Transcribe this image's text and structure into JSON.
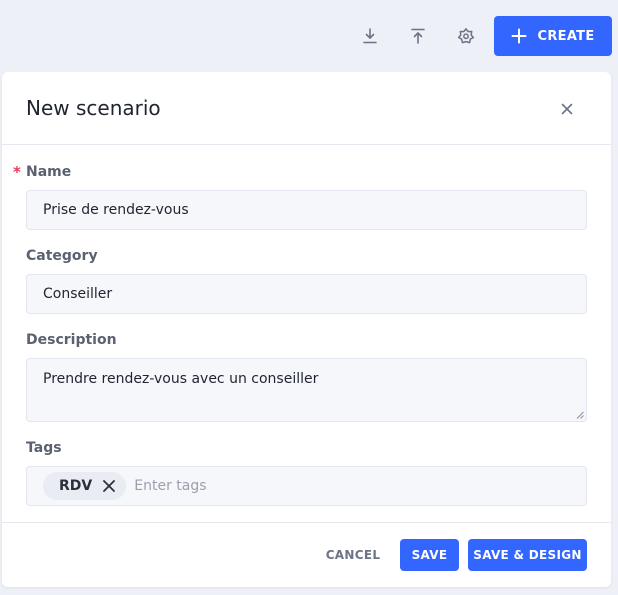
{
  "toolbar": {
    "icons": [
      "download-icon",
      "upload-icon",
      "settings-flower-icon"
    ],
    "create_label": "CREATE"
  },
  "modal": {
    "title": "New scenario",
    "fields": {
      "name": {
        "label": "Name",
        "required_mark": "*",
        "value": "Prise de rendez-vous"
      },
      "category": {
        "label": "Category",
        "value": "Conseiller"
      },
      "description": {
        "label": "Description",
        "value": "Prendre rendez-vous avec un conseiller"
      },
      "tags": {
        "label": "Tags",
        "items": [
          "RDV"
        ],
        "placeholder": "Enter tags"
      }
    },
    "footer": {
      "cancel_label": "CANCEL",
      "save_label": "SAVE",
      "save_design_label": "SAVE & DESIGN"
    }
  },
  "colors": {
    "accent": "#3366ff",
    "required": "#e53950",
    "background": "#eef0f7"
  }
}
